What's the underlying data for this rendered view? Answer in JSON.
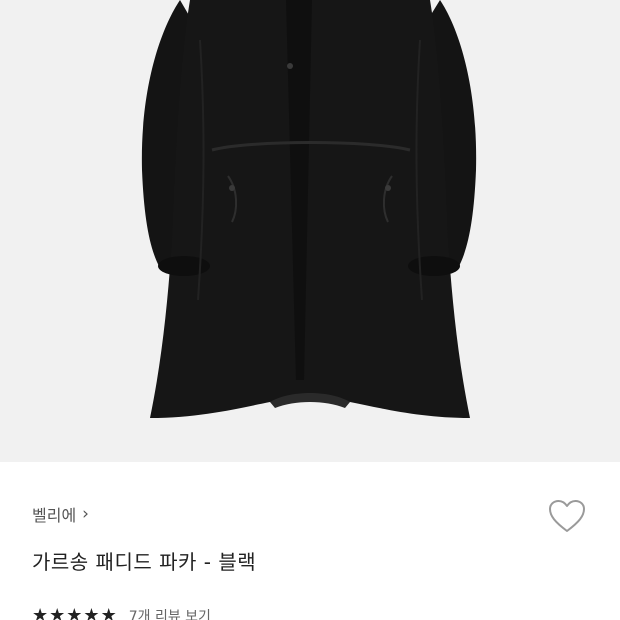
{
  "product": {
    "brand": "벨리에",
    "title": "가르송 패디드 파카 - 블랙",
    "rating_stars": 5,
    "review_link": "7개 리뷰 보기"
  },
  "icons": {
    "brand_chevron": "chevron-right-icon",
    "wishlist": "heart-outline-icon",
    "star": "star-filled-icon"
  },
  "colors": {
    "image_background": "#f1f1f1",
    "coat": "#151515",
    "text_primary": "#222222",
    "text_secondary": "#555555"
  }
}
